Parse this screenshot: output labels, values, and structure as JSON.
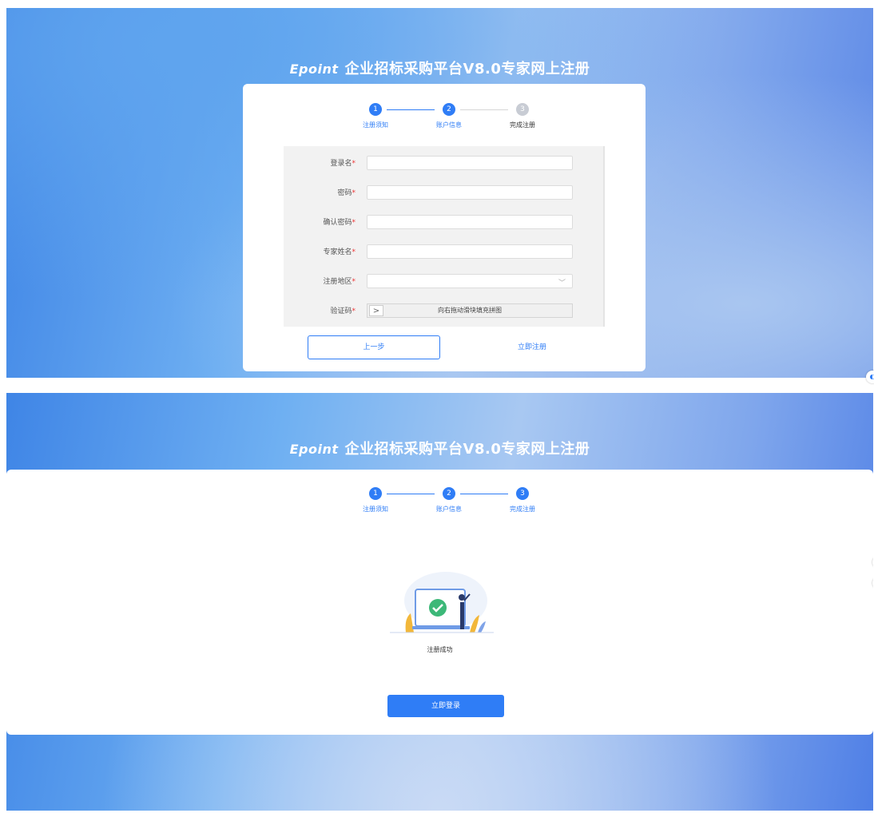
{
  "header": {
    "logo": "Epoint",
    "title": "企业招标采购平台V8.0专家网上注册"
  },
  "steps": [
    {
      "number": "1",
      "label": "注册须知"
    },
    {
      "number": "2",
      "label": "账户信息"
    },
    {
      "number": "3",
      "label": "完成注册"
    }
  ],
  "form": {
    "required_mark": "*",
    "fields": [
      {
        "label": "登录名",
        "value": ""
      },
      {
        "label": "密码",
        "value": ""
      },
      {
        "label": "确认密码",
        "value": ""
      },
      {
        "label": "专家姓名",
        "value": ""
      },
      {
        "label": "注册地区",
        "value": ""
      },
      {
        "label": "验证码",
        "value": ""
      }
    ],
    "captcha_handle": ">",
    "captcha_text": "向右拖动滑块填充拼图",
    "region_chevron": "﹀",
    "prev_button": "上一步",
    "register_button": "立即注册"
  },
  "complete": {
    "message": "注册成功",
    "login_button": "立即登录"
  },
  "colors": {
    "primary": "#2f7df6",
    "inactive_step": "#c8ccd4",
    "required": "#e33333"
  }
}
